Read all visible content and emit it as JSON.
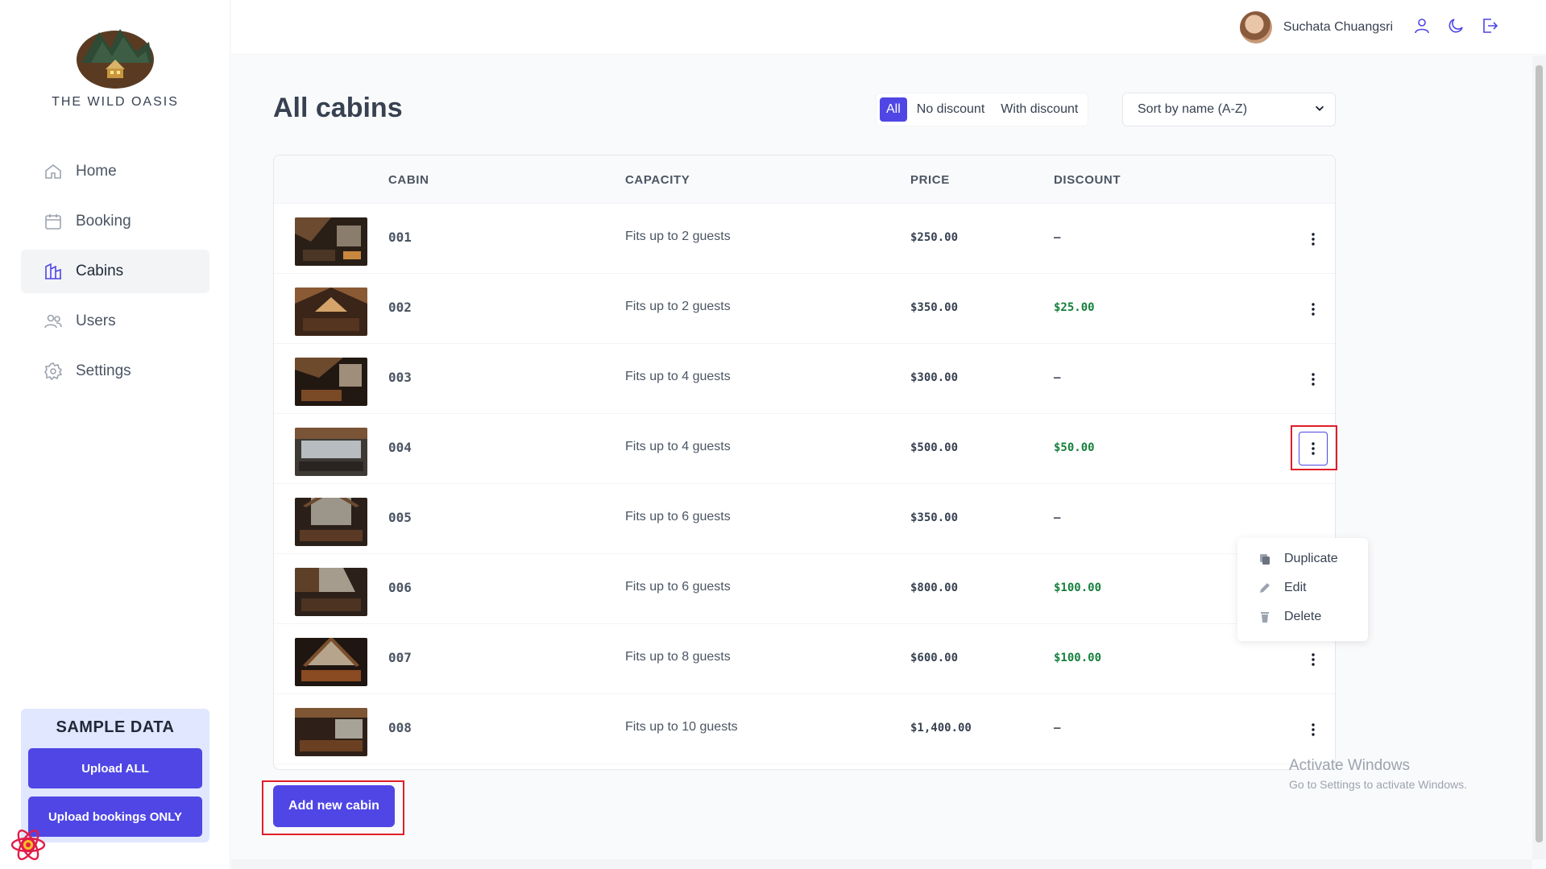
{
  "brand": {
    "name": "THE WILD OASIS"
  },
  "sidebar": {
    "items": [
      {
        "label": "Home",
        "icon": "home-icon",
        "active": false
      },
      {
        "label": "Booking",
        "icon": "calendar-icon",
        "active": false
      },
      {
        "label": "Cabins",
        "icon": "cabins-icon",
        "active": true
      },
      {
        "label": "Users",
        "icon": "users-icon",
        "active": false
      },
      {
        "label": "Settings",
        "icon": "gear-icon",
        "active": false
      }
    ],
    "sample": {
      "title": "SAMPLE DATA",
      "upload_all": "Upload ALL",
      "upload_bookings": "Upload bookings ONLY"
    }
  },
  "header": {
    "user_name": "Suchata Chuangsri",
    "icons": [
      "user-icon",
      "moon-icon",
      "logout-icon"
    ]
  },
  "main": {
    "title": "All cabins",
    "filters": [
      "All",
      "No discount",
      "With discount"
    ],
    "active_filter": "All",
    "sort": "Sort by name (A-Z)",
    "columns": [
      "CABIN",
      "CAPACITY",
      "PRICE",
      "DISCOUNT"
    ],
    "rows": [
      {
        "name": "001",
        "capacity": "Fits up to 2 guests",
        "price": "$250.00",
        "discount": "—"
      },
      {
        "name": "002",
        "capacity": "Fits up to 2 guests",
        "price": "$350.00",
        "discount": "$25.00"
      },
      {
        "name": "003",
        "capacity": "Fits up to 4 guests",
        "price": "$300.00",
        "discount": "—"
      },
      {
        "name": "004",
        "capacity": "Fits up to 4 guests",
        "price": "$500.00",
        "discount": "$50.00"
      },
      {
        "name": "005",
        "capacity": "Fits up to 6 guests",
        "price": "$350.00",
        "discount": "—"
      },
      {
        "name": "006",
        "capacity": "Fits up to 6 guests",
        "price": "$800.00",
        "discount": "$100.00"
      },
      {
        "name": "007",
        "capacity": "Fits up to 8 guests",
        "price": "$600.00",
        "discount": "$100.00"
      },
      {
        "name": "008",
        "capacity": "Fits up to 10 guests",
        "price": "$1,400.00",
        "discount": "—"
      }
    ],
    "menu": {
      "duplicate": "Duplicate",
      "edit": "Edit",
      "delete": "Delete"
    },
    "add_button": "Add new cabin"
  },
  "watermark": {
    "line1": "Activate Windows",
    "line2": "Go to Settings to activate Windows."
  },
  "colors": {
    "accent": "#4f46e5",
    "discount_green": "#15803d",
    "highlight_red": "#e11d2a"
  }
}
